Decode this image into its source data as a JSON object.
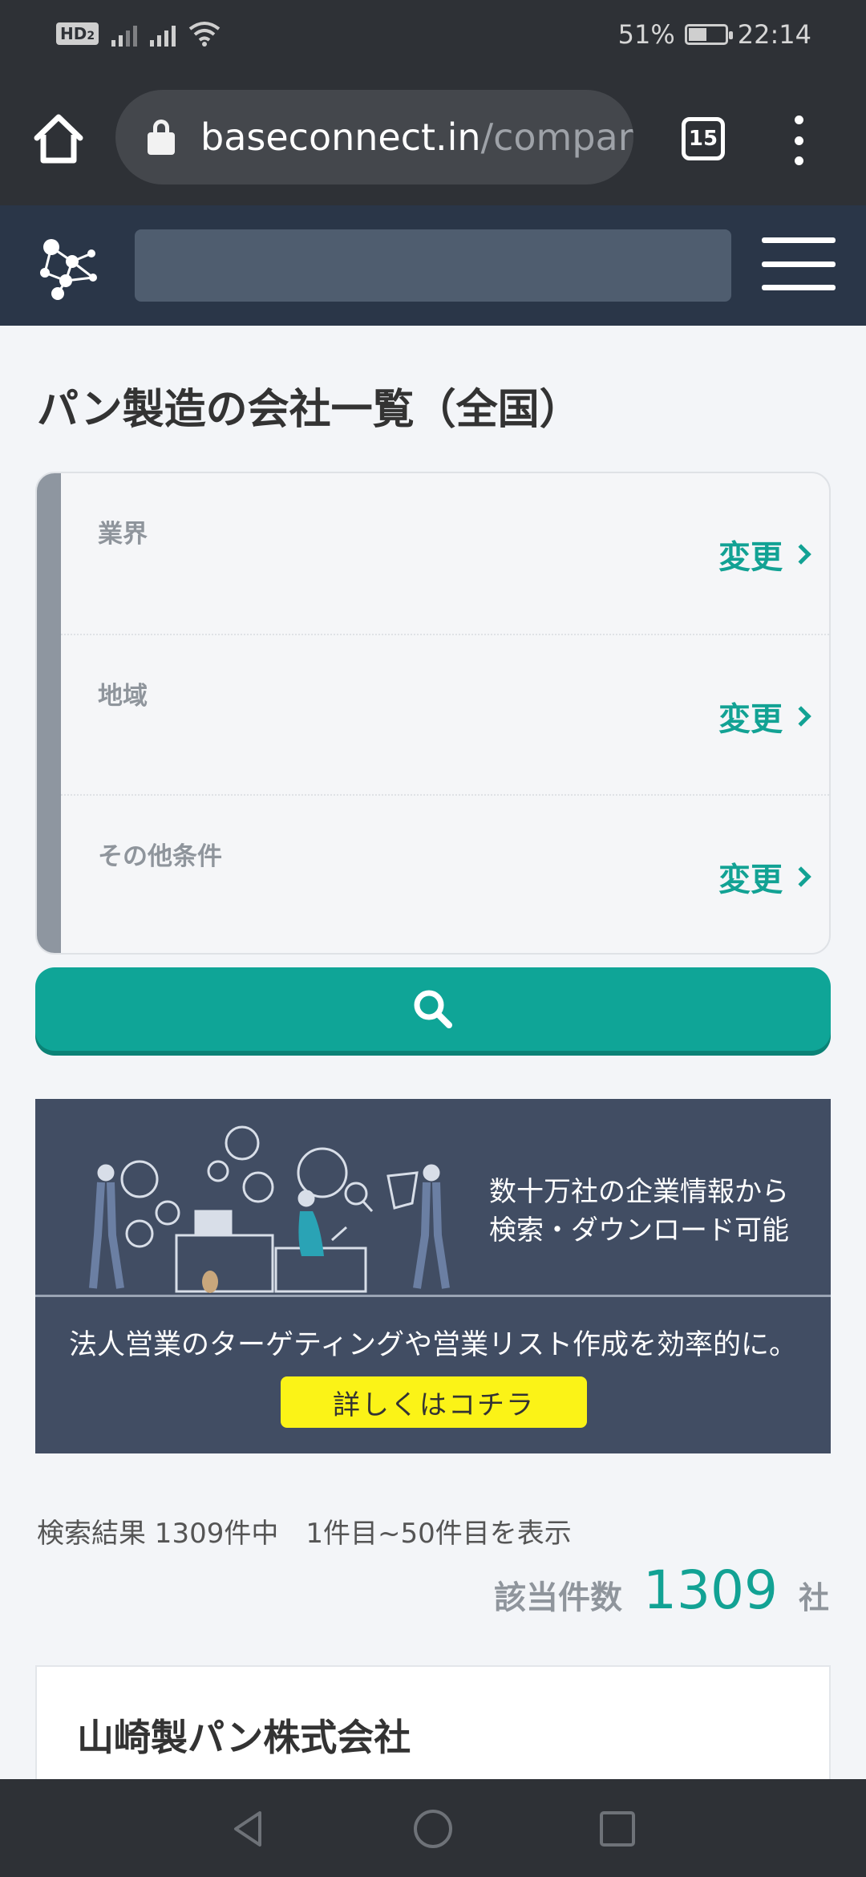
{
  "status_bar": {
    "hd_label": "HD",
    "hd_sub": "2",
    "battery": "51%",
    "time": "22:14",
    "battery_level": 0.51
  },
  "browser": {
    "url_host": "baseconnect.in",
    "url_rest": "/compan",
    "tab_count": "15"
  },
  "page": {
    "title": "パン製造の会社一覧（全国）"
  },
  "filters": [
    {
      "label": "業界",
      "action": "変更"
    },
    {
      "label": "地域",
      "action": "変更"
    },
    {
      "label": "その他条件",
      "action": "変更"
    }
  ],
  "banner": {
    "line1": "数十万社の企業情報から",
    "line2": "検索・ダウンロード可能",
    "tagline": "法人営業のターゲティングや営業リスト作成を効率的に。",
    "cta": "詳しくはコチラ",
    "colors": {
      "background": "#414d63",
      "cta": "#fbf317"
    }
  },
  "results": {
    "summary": "検索結果 1309件中　1件目~50件目を表示",
    "count_label": "該当件数",
    "count_value": "1309",
    "count_unit": "社"
  },
  "companies": [
    {
      "name": "山崎製パン株式会社"
    }
  ],
  "theme": {
    "accent": "#12a294",
    "header_bg": "#2a3648"
  }
}
